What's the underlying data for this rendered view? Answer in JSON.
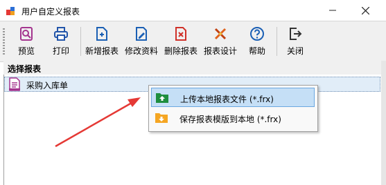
{
  "window": {
    "title": "用户自定义报表"
  },
  "toolbar": {
    "preview": "预览",
    "print": "打印",
    "new_report": "新增报表",
    "edit_info": "修改资料",
    "delete_report": "删除报表",
    "design_report": "报表设计",
    "help": "帮助",
    "close": "关闭"
  },
  "section": {
    "title": "选择报表"
  },
  "reports": [
    {
      "label": "采购入库单"
    }
  ],
  "context_menu": {
    "items": [
      {
        "label": "上传本地报表文件 (*.frx)"
      },
      {
        "label": "保存报表模版到本地 (*.frx)"
      }
    ]
  },
  "colors": {
    "accent": "#c5dff6",
    "arrow": "#e53935",
    "icon_purple": "#a4348e",
    "icon_red": "#d03028"
  }
}
